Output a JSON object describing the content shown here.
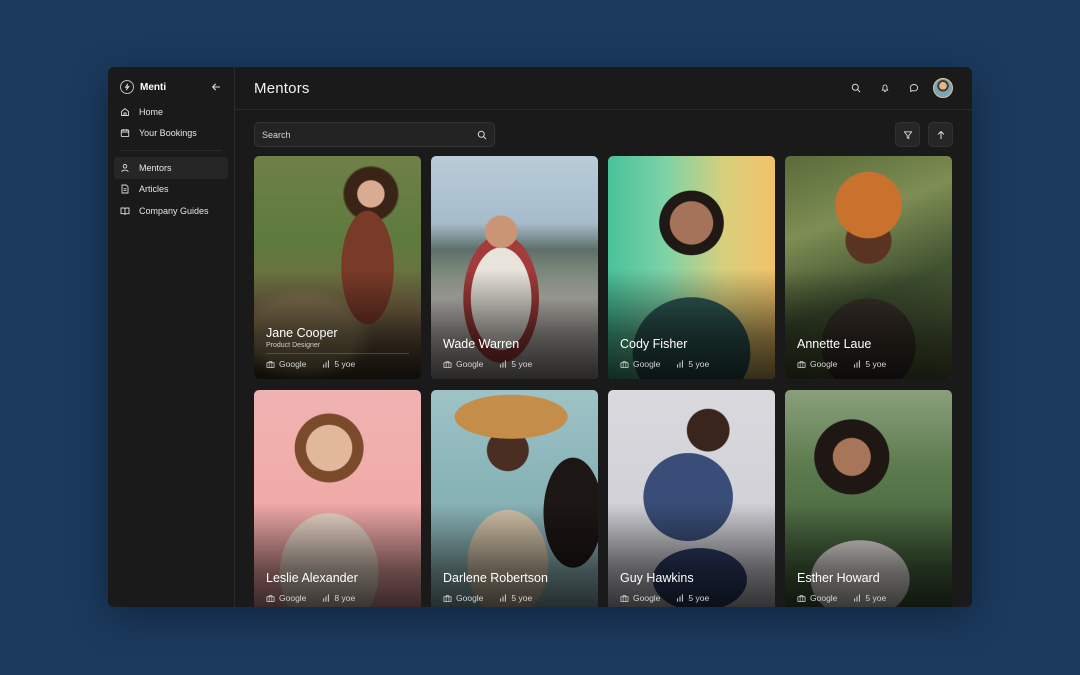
{
  "app": {
    "brand": "Menti",
    "title": "Mentors"
  },
  "sidebar": {
    "items": [
      {
        "label": "Home",
        "icon": "home-icon"
      },
      {
        "label": "Your Bookings",
        "icon": "calendar-icon"
      },
      {
        "label": "Mentors",
        "icon": "user-icon",
        "active": true
      },
      {
        "label": "Articles",
        "icon": "document-icon"
      },
      {
        "label": "Company Guides",
        "icon": "book-icon"
      }
    ]
  },
  "header": {
    "actions": [
      "search-icon",
      "bell-icon",
      "chat-icon",
      "avatar"
    ]
  },
  "search": {
    "placeholder": "Search"
  },
  "toolbar": {
    "filter_icon": "filter-icon",
    "sort_icon": "arrow-up-icon"
  },
  "mentors": [
    {
      "name": "Jane Cooper",
      "role": "Product Designer",
      "company": "Google",
      "yoe": "5 yoe"
    },
    {
      "name": "Wade Warren",
      "company": "Google",
      "yoe": "5 yoe"
    },
    {
      "name": "Cody Fisher",
      "company": "Google",
      "yoe": "5 yoe"
    },
    {
      "name": "Annette Laue",
      "company": "Google",
      "yoe": "5 yoe"
    },
    {
      "name": "Leslie Alexander",
      "company": "Google",
      "yoe": "8 yoe"
    },
    {
      "name": "Darlene Robertson",
      "company": "Google",
      "yoe": "5 yoe"
    },
    {
      "name": "Guy Hawkins",
      "company": "Google",
      "yoe": "5 yoe"
    },
    {
      "name": "Esther Howard",
      "company": "Google",
      "yoe": "5 yoe"
    }
  ],
  "colors": {
    "page_bg": "#1b3a5e",
    "app_bg": "#1a1a1a",
    "sidebar_active": "#262626"
  }
}
